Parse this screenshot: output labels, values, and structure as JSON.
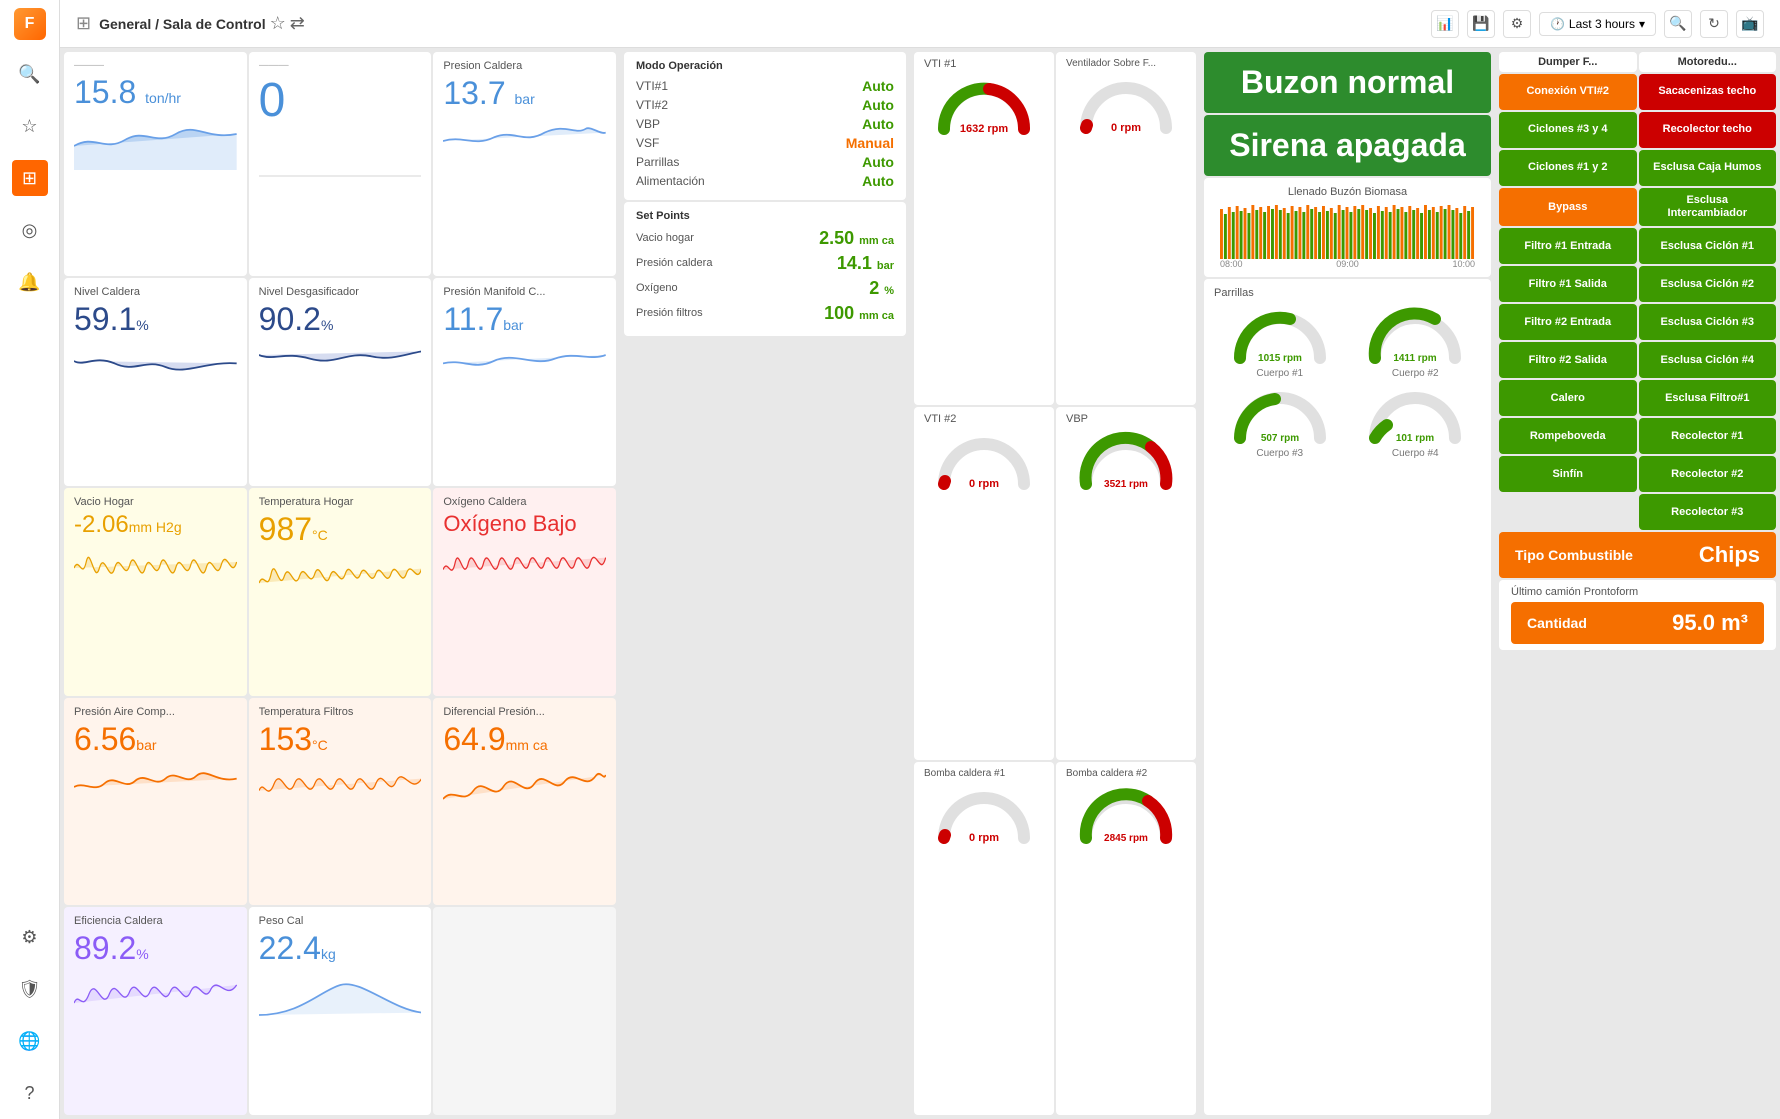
{
  "topbar": {
    "breadcrumb": "General / Sala de Control",
    "time_range": "Last 3 hours"
  },
  "sidebar": {
    "logo": "F",
    "items": [
      {
        "icon": "🔍",
        "name": "search",
        "active": false
      },
      {
        "icon": "☆",
        "name": "starred",
        "active": false
      },
      {
        "icon": "⊞",
        "name": "dashboard",
        "active": true
      },
      {
        "icon": "◎",
        "name": "explore",
        "active": false
      },
      {
        "icon": "🔔",
        "name": "alerts",
        "active": false
      },
      {
        "icon": "⚙",
        "name": "settings",
        "active": false
      },
      {
        "icon": "🛡",
        "name": "admin",
        "active": false
      },
      {
        "icon": "🌐",
        "name": "plugins",
        "active": false
      },
      {
        "icon": "?",
        "name": "help",
        "active": false
      }
    ]
  },
  "metrics": [
    {
      "title": "",
      "value": "15.8",
      "unit": "ton/hr",
      "color": "blue",
      "sparkline_type": "wave"
    },
    {
      "title": "",
      "value": "",
      "unit": "",
      "color": "blue",
      "sparkline_type": "flat"
    },
    {
      "title": "Presion Caldera",
      "value": "13.7",
      "unit": "bar",
      "color": "blue",
      "sparkline_type": "wave2"
    },
    {
      "title": "Nivel Caldera",
      "value": "59.1",
      "unit": "%",
      "color": "dark-blue",
      "sparkline_type": "wave3"
    },
    {
      "title": "Nivel Desgasificador",
      "value": "90.2",
      "unit": "%",
      "color": "dark-blue",
      "sparkline_type": "wave4"
    },
    {
      "title": "Presión Manifold C...",
      "value": "11.7",
      "unit": "bar",
      "color": "blue",
      "sparkline_type": "wave5"
    },
    {
      "title": "Vacio Hogar",
      "value": "-2.06",
      "unit": "mm H2g",
      "color": "yellow",
      "sparkline_type": "noise"
    },
    {
      "title": "Temperatura Hogar",
      "value": "987",
      "unit": "°C",
      "color": "yellow",
      "sparkline_type": "noise2"
    },
    {
      "title": "Oxígeno Caldera",
      "value": "Oxígeno Bajo",
      "unit": "",
      "color": "pink",
      "sparkline_type": "noise3"
    },
    {
      "title": "Presión Aire Comp...",
      "value": "6.56",
      "unit": "bar",
      "color": "orange",
      "sparkline_type": "noise4"
    },
    {
      "title": "Temperatura Filtros",
      "value": "153",
      "unit": "°C",
      "color": "orange",
      "sparkline_type": "noise5"
    },
    {
      "title": "Diferencial Presión...",
      "value": "64.9",
      "unit": "mm ca",
      "color": "orange",
      "sparkline_type": "noise6"
    },
    {
      "title": "Eficiencia Caldera",
      "value": "89.2",
      "unit": "%",
      "color": "purple",
      "sparkline_type": "noise7"
    },
    {
      "title": "Peso Cal",
      "value": "22.4",
      "unit": "kg",
      "color": "blue",
      "sparkline_type": "flat2"
    }
  ],
  "modo_operacion": {
    "title": "Modo Operación",
    "rows": [
      {
        "label": "VTI#1",
        "status": "Auto",
        "color": "green"
      },
      {
        "label": "VTI#2",
        "status": "Auto",
        "color": "green"
      },
      {
        "label": "VBP",
        "status": "Auto",
        "color": "green"
      },
      {
        "label": "VSF",
        "status": "Manual",
        "color": "orange"
      },
      {
        "label": "Parrillas",
        "status": "Auto",
        "color": "green"
      },
      {
        "label": "Alimentación",
        "status": "Auto",
        "color": "green"
      }
    ]
  },
  "set_points": {
    "title": "Set Points",
    "rows": [
      {
        "label": "Vacio hogar",
        "value": "2.50",
        "unit": "mm ca"
      },
      {
        "label": "Presión caldera",
        "value": "14.1",
        "unit": "bar"
      },
      {
        "label": "Oxígeno",
        "value": "2",
        "unit": "%"
      },
      {
        "label": "Presión filtros",
        "value": "100",
        "unit": "mm ca"
      }
    ]
  },
  "buzon": {
    "normal": "Buzon normal",
    "sirena": "Sirena apagada",
    "llenado_title": "Llenado Buzón Biomasa",
    "axis": [
      "08:00",
      "09:00",
      "10:00"
    ]
  },
  "fans": [
    {
      "title": "VTI #1",
      "rpm": "1632 rpm",
      "status": "normal"
    },
    {
      "title": "Ventilador Sobre F...",
      "rpm": "0 rpm",
      "status": "stopped"
    },
    {
      "title": "VTI #2",
      "rpm": "0 rpm",
      "status": "stopped"
    },
    {
      "title": "VBP",
      "rpm": "3521 rpm",
      "status": "normal"
    },
    {
      "title": "Bomba caldera #1",
      "rpm": "0 rpm",
      "status": "stopped"
    },
    {
      "title": "Bomba caldera #2",
      "rpm": "2845 rpm",
      "status": "normal"
    }
  ],
  "parrillas": {
    "title": "Parrillas",
    "cuerpos": [
      {
        "label": "Cuerpo #1",
        "rpm": "1015 rpm"
      },
      {
        "label": "Cuerpo #2",
        "rpm": "1411 rpm"
      },
      {
        "label": "Cuerpo #3",
        "rpm": "507 rpm"
      },
      {
        "label": "Cuerpo #4",
        "rpm": "101 rpm"
      }
    ]
  },
  "right_panel": {
    "col1_header": "Dumper F...",
    "col2_header": "Motoredu...",
    "buttons_col1": [
      {
        "label": "Conexión VTI#2",
        "color": "orange"
      },
      {
        "label": "Ciclones #3 y 4",
        "color": "green"
      },
      {
        "label": "Ciclones #1 y 2",
        "color": "green"
      },
      {
        "label": "Bypass",
        "color": "orange"
      },
      {
        "label": "Filtro #1 Entrada",
        "color": "green"
      },
      {
        "label": "Filtro #1 Salida",
        "color": "green"
      },
      {
        "label": "Filtro #2 Entrada",
        "color": "green"
      },
      {
        "label": "Filtro #2 Salida",
        "color": "green"
      },
      {
        "label": "Calero",
        "color": "green"
      },
      {
        "label": "Rompeboveda",
        "color": "green"
      },
      {
        "label": "Sinfín",
        "color": "green"
      }
    ],
    "buttons_col2": [
      {
        "label": "Sacacenizas techo",
        "color": "red"
      },
      {
        "label": "Recolector techo",
        "color": "red"
      },
      {
        "label": "Esclusa Caja Humos",
        "color": "green"
      },
      {
        "label": "Esclusa Intercambiador",
        "color": "green"
      },
      {
        "label": "Esclusa Ciclón #1",
        "color": "green"
      },
      {
        "label": "Esclusa Ciclón #2",
        "color": "green"
      },
      {
        "label": "Esclusa Ciclón #3",
        "color": "green"
      },
      {
        "label": "Esclusa Ciclón #4",
        "color": "green"
      },
      {
        "label": "Esclusa Filtro#1",
        "color": "green"
      },
      {
        "label": "Recolector #1",
        "color": "green"
      },
      {
        "label": "Recolector #2",
        "color": "green"
      },
      {
        "label": "Recolector #3",
        "color": "green"
      }
    ],
    "tipo_combustible_label": "Tipo Combustible",
    "tipo_combustible_value": "Chips",
    "ultimo_title": "Último camión Prontoform",
    "cantidad_label": "Cantidad",
    "cantidad_value": "95.0 m³"
  }
}
